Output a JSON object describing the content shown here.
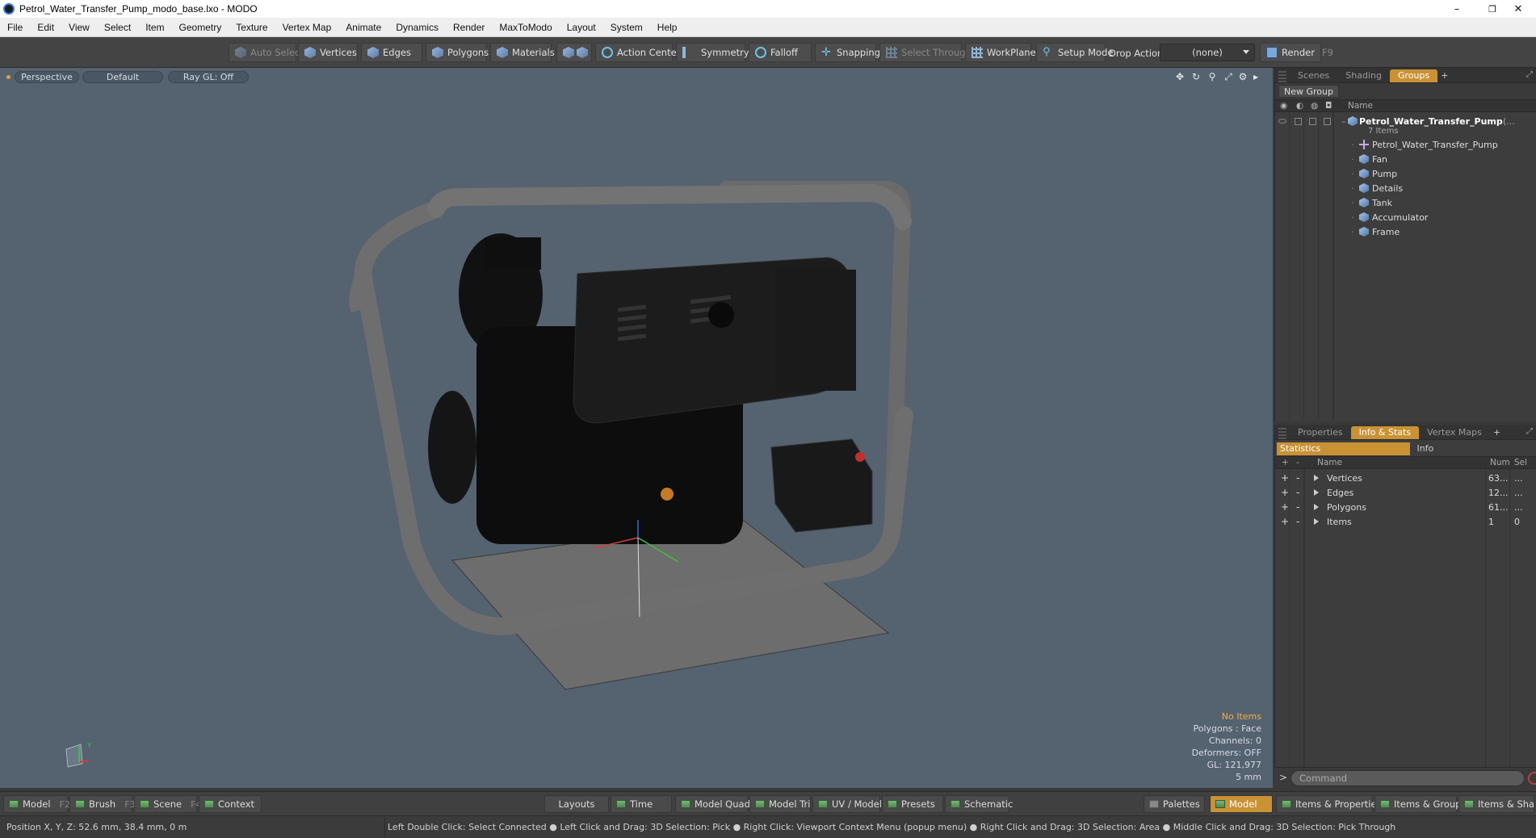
{
  "window": {
    "title": "Petrol_Water_Transfer_Pump_modo_base.lxo - MODO",
    "minimize": "–",
    "maximize": "❐",
    "close": "✕"
  },
  "menu": [
    "File",
    "Edit",
    "View",
    "Select",
    "Item",
    "Geometry",
    "Texture",
    "Vertex Map",
    "Animate",
    "Dynamics",
    "Render",
    "MaxToModo",
    "Layout",
    "System",
    "Help"
  ],
  "toolbar": {
    "auto_select": "Auto Select",
    "vertices": "Vertices",
    "edges": "Edges",
    "polygons": "Polygons",
    "materials": "Materials",
    "action_center": "Action Center",
    "symmetry": "Symmetry",
    "falloff": "Falloff",
    "snapping": "Snapping",
    "select_through": "Select Through",
    "workplane": "WorkPlane",
    "setup_mode": "Setup Mode",
    "drop_action_label": "Drop Action",
    "drop_action_value": "(none)",
    "render": "Render",
    "render_key": "F9"
  },
  "viewport": {
    "view": "Perspective",
    "shading": "Default",
    "raygl": "Ray GL: Off",
    "overlay": {
      "no_items": "No Items",
      "polygons": "Polygons : Face",
      "channels": "Channels: 0",
      "deformers": "Deformers: OFF",
      "gl": "GL: 121,977",
      "scale": "5 mm"
    },
    "axis_y": "Y",
    "axis_x": "X"
  },
  "groups_panel": {
    "tabs": [
      "Scenes",
      "Shading",
      "Groups"
    ],
    "active_tab": "Groups",
    "add": "+",
    "new_group": "New Group",
    "col_name": "Name",
    "root": {
      "name": "Petrol_Water_Transfer_Pump",
      "suffix": "(...",
      "count": "7 Items"
    },
    "items": [
      "Petrol_Water_Transfer_Pump",
      "Fan",
      "Pump",
      "Details",
      "Tank",
      "Accumulator",
      "Frame"
    ]
  },
  "stats_panel": {
    "tabs": [
      "Properties",
      "Info & Stats",
      "Vertex Maps"
    ],
    "active_tab": "Info & Stats",
    "add": "+",
    "subtabs": [
      "Statistics",
      "Info"
    ],
    "col_name": "Name",
    "col_num": "Num",
    "col_sel": "Sel",
    "rows": [
      {
        "name": "Vertices",
        "num": "63...",
        "sel": "..."
      },
      {
        "name": "Edges",
        "num": "12...",
        "sel": "..."
      },
      {
        "name": "Polygons",
        "num": "61...",
        "sel": "..."
      },
      {
        "name": "Items",
        "num": "1",
        "sel": "0"
      }
    ]
  },
  "bottombar": {
    "model": "Model",
    "model_key": "F2",
    "brush": "Brush",
    "brush_key": "F3",
    "scene": "Scene",
    "scene_key": "F4",
    "context": "Context",
    "layouts": "Layouts",
    "time": "Time",
    "model_quad": "Model Quad",
    "model_tri": "Model Tri",
    "uv_model": "UV / Model",
    "presets": "Presets",
    "schematic": "Schematic",
    "palettes": "Palettes",
    "model_active": "Model",
    "items_properties": "Items & Properties",
    "items_groups": "Items & Groups",
    "items_shading": "Items & Shading",
    "command_prompt": ">",
    "command_placeholder": "Command"
  },
  "status": {
    "position": "Position X, Y, Z:   52.6 mm, 38.4 mm, 0 m",
    "hints": "Left Double Click: Select Connected ● Left Click and Drag: 3D Selection: Pick ● Right Click: Viewport Context Menu (popup menu) ● Right Click and Drag: 3D Selection: Area ● Middle Click and Drag: 3D Selection: Pick Through"
  }
}
